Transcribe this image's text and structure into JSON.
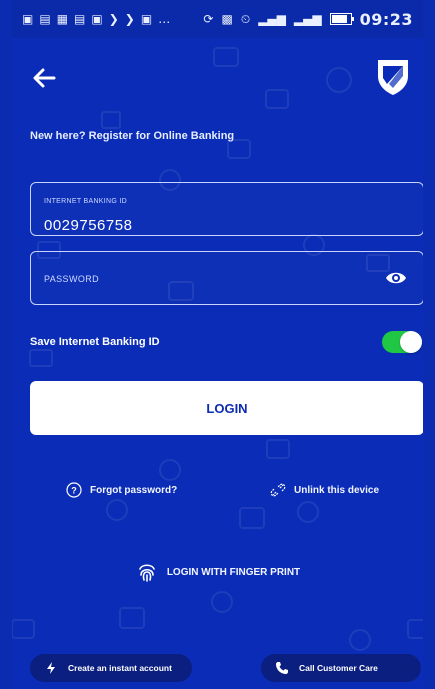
{
  "status_bar": {
    "time": "09:23",
    "battery_level": 0.85
  },
  "header": {
    "back_icon": "arrow-left-icon",
    "logo": "bank-shield-logo"
  },
  "register": {
    "text": "New here? Register for Online Banking"
  },
  "fields": {
    "banking_id": {
      "label": "INTERNET BANKING ID",
      "value": "0029756758"
    },
    "password": {
      "placeholder": "PASSWORD",
      "icon": "eye-icon"
    }
  },
  "save_toggle": {
    "label": "Save Internet Banking ID",
    "on": true,
    "color": "#20c744"
  },
  "login": {
    "label": "LOGIN"
  },
  "links": {
    "forgot": {
      "label": "Forgot password?",
      "icon": "question-circle-icon"
    },
    "unlink": {
      "label": "Unlink this device",
      "icon": "unlink-icon"
    }
  },
  "fingerprint": {
    "label": "LOGIN WITH FINGER PRINT",
    "icon": "fingerprint-icon"
  },
  "bottom": {
    "create_account": {
      "label": "Create an instant account",
      "icon": "bolt-icon"
    },
    "call_care": {
      "label": "Call Customer Care",
      "icon": "phone-icon"
    }
  },
  "colors": {
    "background": "#0a2cb6",
    "button_text": "#0b2bb0"
  }
}
